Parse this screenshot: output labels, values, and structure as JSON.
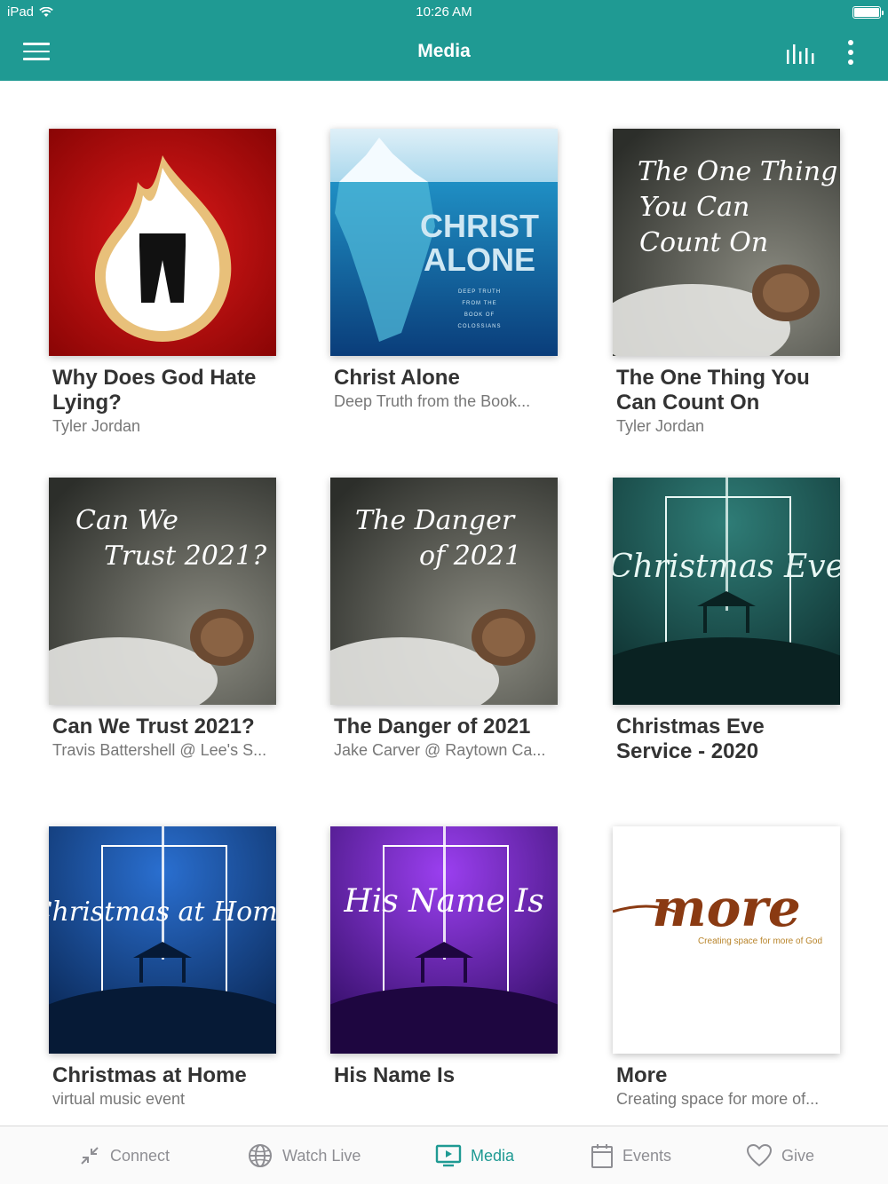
{
  "status_bar": {
    "carrier": "iPad",
    "time": "10:26 AM"
  },
  "navbar": {
    "title": "Media"
  },
  "media_items": [
    {
      "title": "Why Does God Hate Lying?",
      "subtitle": "Tyler Jordan",
      "art_text": ""
    },
    {
      "title": "Christ Alone",
      "subtitle": "Deep Truth from the Book...",
      "art_text": "CHRIST ALONE"
    },
    {
      "title": "The One Thing You Can Count On",
      "subtitle": "Tyler Jordan",
      "art_text": "The One Thing You Can Count On"
    },
    {
      "title": "Can We Trust 2021?",
      "subtitle": "Travis Battershell @ Lee's S...",
      "art_text": "Can We Trust 2021?"
    },
    {
      "title": "The Danger of 2021",
      "subtitle": "Jake Carver @ Raytown Ca...",
      "art_text": "The Danger of 2021"
    },
    {
      "title": "Christmas Eve Service - 2020",
      "subtitle": "",
      "art_text": "Christmas Eve"
    },
    {
      "title": "Christmas at Home",
      "subtitle": "virtual music event",
      "art_text": "Christmas at Home"
    },
    {
      "title": "His Name Is",
      "subtitle": "",
      "art_text": "His Name Is"
    },
    {
      "title": "More",
      "subtitle": "Creating space for more of...",
      "art_text": "more"
    }
  ],
  "art": {
    "christ_alone_small": "DEEP TRUTH FROM THE BOOK OF COLOSSIANS",
    "more_tagline": "Creating space for more of God"
  },
  "tabs": [
    {
      "label": "Connect",
      "icon": "connect-icon",
      "active": false
    },
    {
      "label": "Watch Live",
      "icon": "globe-icon",
      "active": false
    },
    {
      "label": "Media",
      "icon": "media-icon",
      "active": true
    },
    {
      "label": "Events",
      "icon": "calendar-icon",
      "active": false
    },
    {
      "label": "Give",
      "icon": "heart-icon",
      "active": false
    }
  ],
  "colors": {
    "brand": "#1f9a93",
    "tab_inactive": "#8e8e93"
  }
}
